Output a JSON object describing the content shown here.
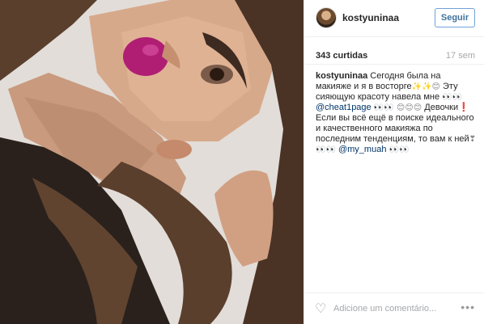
{
  "post": {
    "username": "kostyuninaa",
    "follow_label": "Seguir",
    "likes": "343 curtidas",
    "time": "17 sem",
    "caption": {
      "user": "kostyuninaa",
      "text_1": " Сегодня была на макияже и я в восторге",
      "emoji_1": "✨✨😊",
      "text_2": " Эту сияющую красоту навела мне ",
      "emoji_2": "👀👀",
      "mention_1": "@cheat1page",
      "emoji_3": " 👀👀 😊😊😊",
      "text_3": " Девочки",
      "text_3b": "❗ Если вы всё ещё в поиске идеального и качественного макияжа по последним тенденциям, то вам к ней",
      "emoji_4": "❣👀👀",
      "mention_2": "@my_muah",
      "emoji_5": " 👀👀"
    },
    "comment_placeholder": "Adicione um comentário...",
    "more_label": "•••",
    "heart_icon": "♡"
  },
  "colors": {
    "link": "#003569",
    "follow": "#3f729b",
    "muted": "#a5a7aa"
  }
}
